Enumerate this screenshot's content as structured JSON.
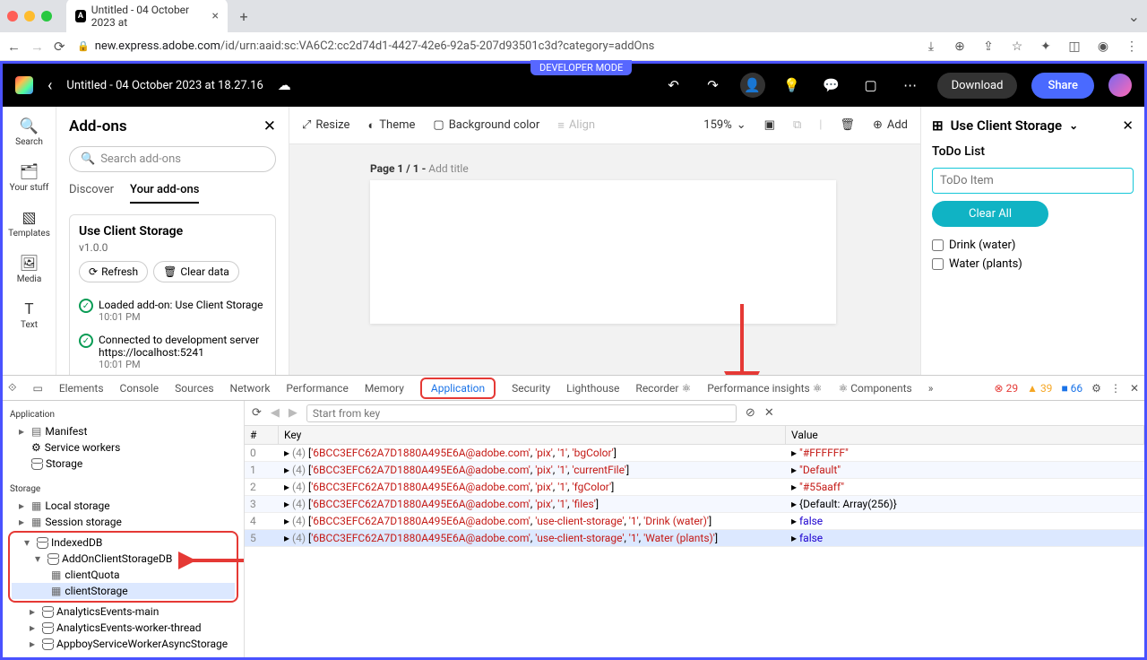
{
  "browser": {
    "tab_title": "Untitled - 04 October 2023 at",
    "url_domain": "new.express.adobe.com",
    "url_path": "/id/urn:aaid:sc:VA6C2:cc2d74d1-4427-42e6-92a5-207d93501c3d?category=addOns"
  },
  "header": {
    "dev_mode": "DEVELOPER MODE",
    "title": "Untitled - 04 October 2023 at 18.27.16",
    "download": "Download",
    "share": "Share"
  },
  "rail": {
    "search": "Search",
    "yourstuff": "Your stuff",
    "templates": "Templates",
    "media": "Media",
    "text": "Text"
  },
  "addons": {
    "title": "Add-ons",
    "search_ph": "Search add-ons",
    "tab_discover": "Discover",
    "tab_yours": "Your add-ons",
    "card_title": "Use Client Storage",
    "card_ver": "v1.0.0",
    "refresh": "Refresh",
    "clear": "Clear data",
    "log1": "Loaded add-on: Use Client Storage",
    "log1_time": "10:01 PM",
    "log2": "Connected to development server https://localhost:5241",
    "log2_time": "10:01 PM"
  },
  "toolbar": {
    "resize": "Resize",
    "theme": "Theme",
    "bgcolor": "Background color",
    "align": "Align",
    "zoom": "159%",
    "add": "Add"
  },
  "pagelabel": {
    "pre": "Page 1 / 1 - ",
    "add": "Add title"
  },
  "rpanel": {
    "title": "Use Client Storage",
    "todo_title": "ToDo List",
    "todo_ph": "ToDo Item",
    "clear": "Clear All",
    "items": [
      "Drink (water)",
      "Water (plants)"
    ]
  },
  "devtools": {
    "tabs": [
      "Elements",
      "Console",
      "Sources",
      "Network",
      "Performance",
      "Memory",
      "Application",
      "Security",
      "Lighthouse",
      "Recorder",
      "Performance insights",
      "Components"
    ],
    "err": "29",
    "warn": "39",
    "info": "66",
    "filter_ph": "Start from key",
    "side": {
      "application": "Application",
      "manifest": "Manifest",
      "sw": "Service workers",
      "storage_top": "Storage",
      "storage": "Storage",
      "ls": "Local storage",
      "ss": "Session storage",
      "idb": "IndexedDB",
      "db": "AddOnClientStorageDB",
      "q": "clientQuota",
      "cs": "clientStorage",
      "ae1": "AnalyticsEvents-main",
      "ae2": "AnalyticsEvents-worker-thread",
      "ab": "AppboyServiceWorkerAsyncStorage"
    },
    "th": {
      "n": "#",
      "k": "Key",
      "v": "Value"
    },
    "rows": [
      {
        "i": "0",
        "n": "4",
        "key_parts": [
          "'6BCC3EFC62A7D1880A495E6A@adobe.com'",
          "'pix'",
          "'1'",
          "'bgColor'"
        ],
        "val_type": "s",
        "val": "\"#FFFFFF\""
      },
      {
        "i": "1",
        "n": "4",
        "key_parts": [
          "'6BCC3EFC62A7D1880A495E6A@adobe.com'",
          "'pix'",
          "'1'",
          "'currentFile'"
        ],
        "val_type": "s",
        "val": "\"Default\""
      },
      {
        "i": "2",
        "n": "4",
        "key_parts": [
          "'6BCC3EFC62A7D1880A495E6A@adobe.com'",
          "'pix'",
          "'1'",
          "'fgColor'"
        ],
        "val_type": "s",
        "val": "\"#55aaff\""
      },
      {
        "i": "3",
        "n": "4",
        "key_parts": [
          "'6BCC3EFC62A7D1880A495E6A@adobe.com'",
          "'pix'",
          "'1'",
          "'files'"
        ],
        "val_type": "o",
        "val": "{Default: Array(256)}"
      },
      {
        "i": "4",
        "n": "4",
        "key_parts": [
          "'6BCC3EFC62A7D1880A495E6A@adobe.com'",
          "'use-client-storage'",
          "'1'",
          "'Drink (water)'"
        ],
        "val_type": "n",
        "val": "false"
      },
      {
        "i": "5",
        "n": "4",
        "key_parts": [
          "'6BCC3EFC62A7D1880A495E6A@adobe.com'",
          "'use-client-storage'",
          "'1'",
          "'Water (plants)'"
        ],
        "val_type": "n",
        "val": "false",
        "sel": true
      }
    ]
  }
}
